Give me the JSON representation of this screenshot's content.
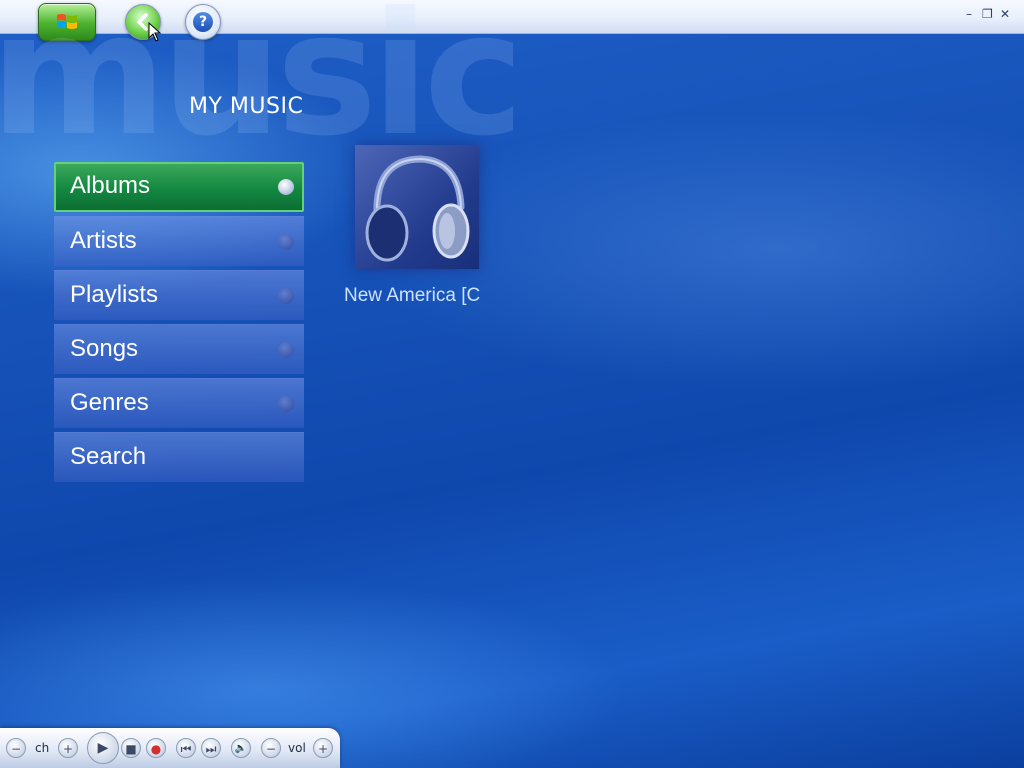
{
  "watermark": "music",
  "page_title": "MY MUSIC",
  "menu": {
    "items": [
      {
        "label": "Albums",
        "selected": true
      },
      {
        "label": "Artists"
      },
      {
        "label": "Playlists"
      },
      {
        "label": "Songs"
      },
      {
        "label": "Genres"
      },
      {
        "label": "Search"
      }
    ]
  },
  "album": {
    "title": "New America [C",
    "icon": "headphones-icon"
  },
  "window_controls": {
    "minimize": "–",
    "restore": "❐",
    "close": "✕"
  },
  "transport": {
    "ch_label": "ch",
    "vol_label": "vol",
    "buttons": {
      "ch_down": "−",
      "ch_up": "+",
      "play": "▶",
      "stop": "■",
      "record": "●",
      "prev": "⏮",
      "next": "⏭",
      "mute": "🔈",
      "vol_down": "−",
      "vol_up": "+"
    }
  },
  "help_glyph": "?",
  "colors": {
    "selected_item": "#138842",
    "background": "#1652b8"
  }
}
